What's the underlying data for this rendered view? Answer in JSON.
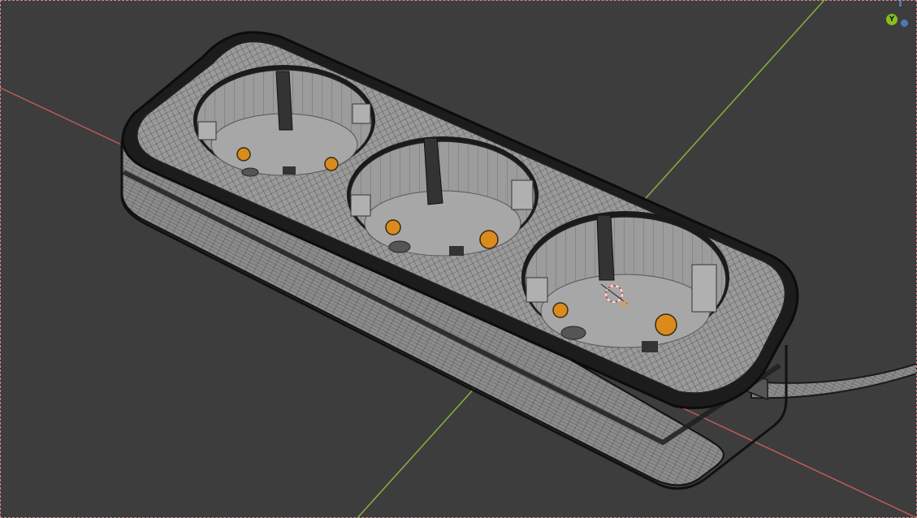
{
  "viewport": {
    "background": "#3d3d3d",
    "axis_x_color": "#c65a5a",
    "axis_y_color": "#7fae3c"
  },
  "object": {
    "name": "power-strip-3-socket",
    "sockets": 3,
    "mesh_color": "#8f8f8f",
    "wire_color": "#1f1f1f",
    "pin_color": "#d98b1e"
  },
  "gizmo": {
    "y_label": "Y",
    "y_color": "#84c11f",
    "z_color": "#4e78b5"
  }
}
